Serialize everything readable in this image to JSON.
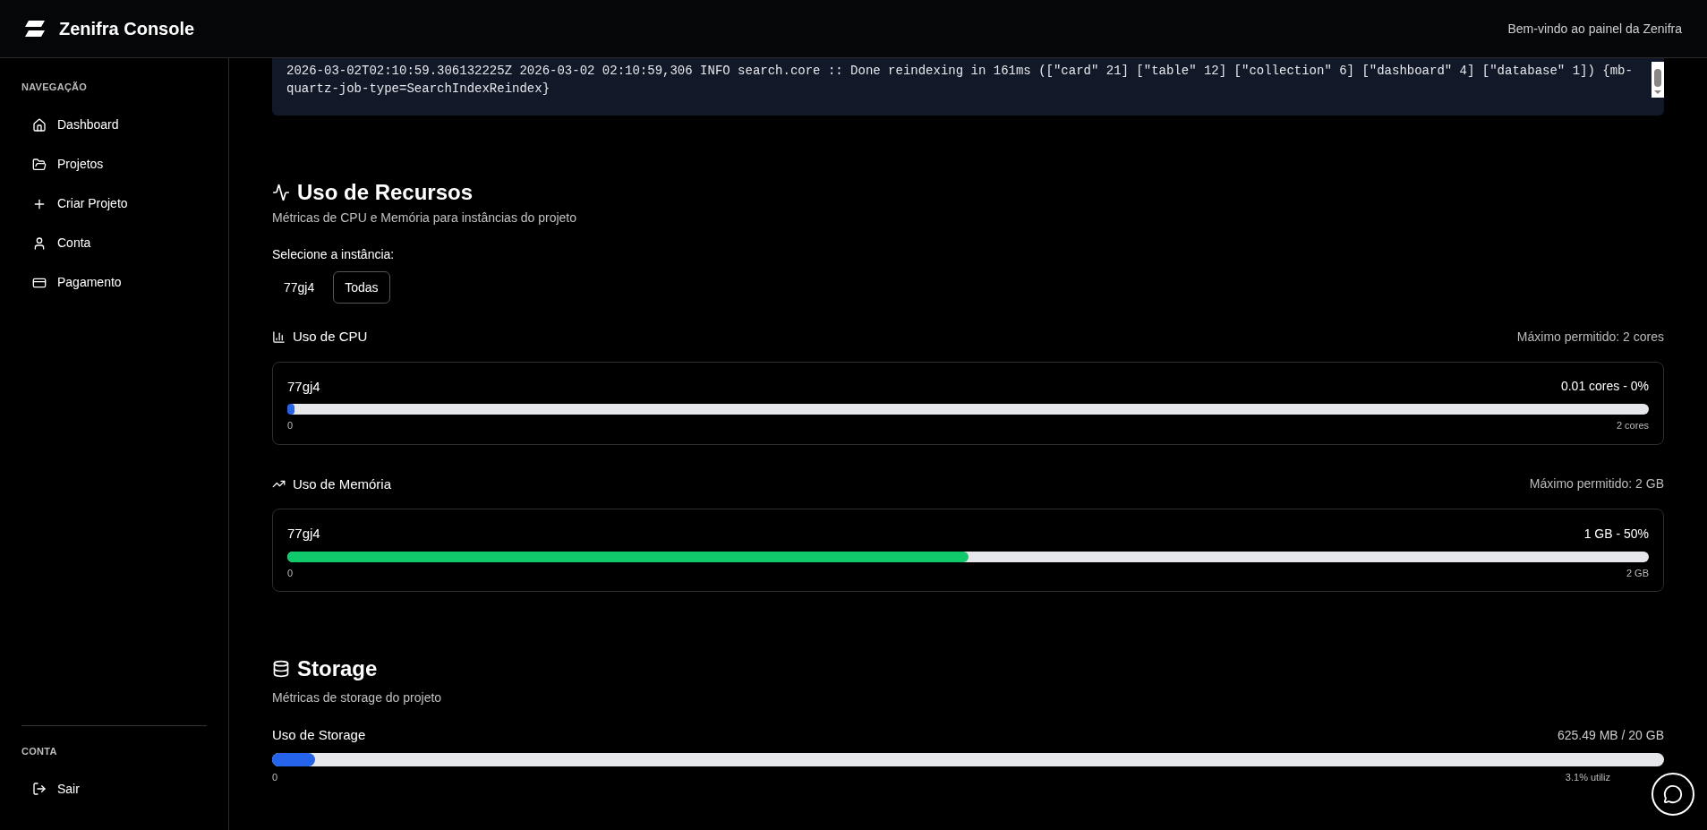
{
  "header": {
    "title": "Zenifra Console",
    "welcome": "Bem-vindo ao painel da Zenifra"
  },
  "sidebar": {
    "sections": [
      {
        "title": "NAVEGAÇÃO",
        "items": [
          {
            "label": "Dashboard",
            "kind": "home"
          },
          {
            "label": "Projetos",
            "kind": "folder"
          },
          {
            "label": "Criar Projeto",
            "kind": "plus"
          },
          {
            "label": "Conta",
            "kind": "user"
          },
          {
            "label": "Pagamento",
            "kind": "card"
          }
        ]
      },
      {
        "title": "CONTA",
        "items": [
          {
            "label": "Sair",
            "kind": "logout"
          }
        ]
      }
    ]
  },
  "log": {
    "lines": [
      "2026-03-02T02:10:59.306132225Z 2026-03-02 02:10:59,306 INFO search.core :: Done reindexing in 161ms ([\"card\" 21] [\"table\" 12] [\"collection\" 6] [\"dashboard\" 4] [\"database\" 1]) {mb-quartz-job-type=SearchIndexReindex}"
    ]
  },
  "resources": {
    "title": "Uso de Recursos",
    "subtitle": "Métricas de CPU e Memória para instâncias do projeto",
    "instance_label": "Selecione a instância:",
    "instances": [
      {
        "label": "77gj4",
        "selected": false
      },
      {
        "label": "Todas",
        "selected": true
      }
    ],
    "metrics": [
      {
        "kind": "cpu",
        "title": "Uso de CPU",
        "limit": "Máximo permitido: 2 cores",
        "instance": "77gj4",
        "reading": "0.01 cores - 0%",
        "level": 0.005,
        "color": "#2563eb",
        "min": "0",
        "max": "2 cores"
      },
      {
        "kind": "memory",
        "title": "Uso de Memória",
        "limit": "Máximo permitido: 2 GB",
        "instance": "77gj4",
        "reading": "1 GB - 50%",
        "level": 0.5,
        "color": "#10c96a",
        "min": "0",
        "max": "2 GB"
      }
    ]
  },
  "storage": {
    "title": "Storage",
    "subtitle": "Métricas de storage do projeto",
    "label": "Uso de Storage",
    "reading": "625.49 MB / 20 GB",
    "level": 0.031,
    "min": "0",
    "max": "3.1% utiliz"
  }
}
